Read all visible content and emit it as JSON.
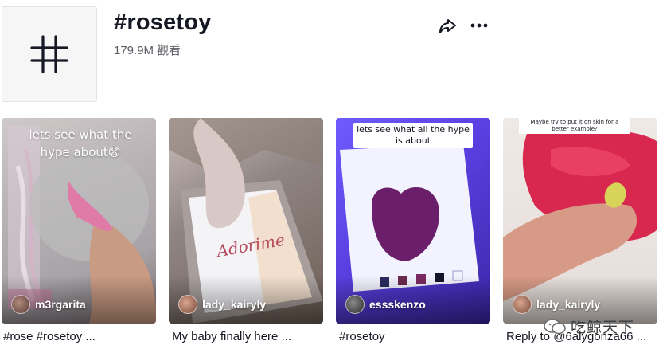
{
  "header": {
    "title": "#rosetoy",
    "views_count": "179.9M",
    "views_label": "觀看",
    "share_icon": "share-icon",
    "more_icon": "more-icon"
  },
  "colors": {
    "text": "#161823",
    "secondary": "#5a5b63"
  },
  "videos": [
    {
      "overlay": "lets see what the hype about😧",
      "author": "m3rgarita",
      "caption": "#rose #rosetoy ..."
    },
    {
      "overlay": "Adorime",
      "author": "lady_kairyly",
      "caption": "My baby finally here ..."
    },
    {
      "overlay": "lets see what all the hype is about",
      "author": "essskenzo",
      "caption": "#rosetoy"
    },
    {
      "overlay": "Maybe try to put it on skin for a better example?",
      "author": "lady_kairyly",
      "caption": "Reply to @6alygonza66 ..."
    }
  ],
  "watermark": {
    "text": "吃鲸天下"
  }
}
